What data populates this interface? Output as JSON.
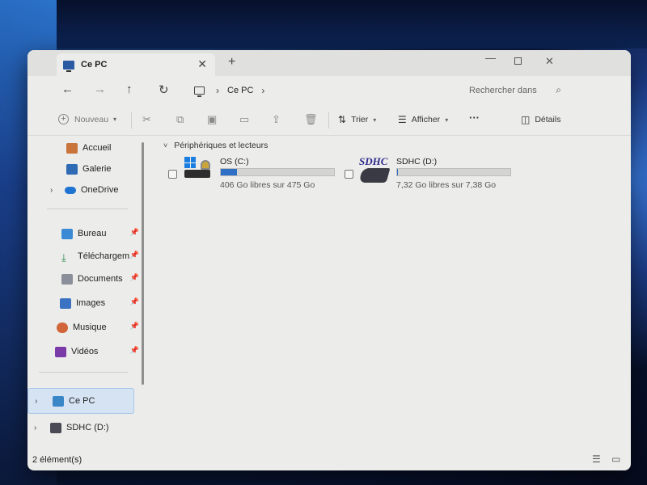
{
  "window": {
    "tab_title": "Ce PC",
    "tab_close": "✕",
    "new_tab": "+",
    "minimize": "—",
    "close": "✕"
  },
  "nav": {
    "back": "←",
    "forward": "→",
    "up": "↑",
    "refresh": "↻"
  },
  "address": {
    "sep1": "›",
    "crumb": "Ce PC",
    "sep2": "›"
  },
  "search": {
    "placeholder": "Rechercher dans"
  },
  "commands": {
    "new_label": "Nouveau",
    "sort_label": "Trier",
    "view_label": "Afficher",
    "more": "···",
    "details_label": "Détails"
  },
  "sidebar": {
    "top": [
      {
        "label": "Accueil"
      },
      {
        "label": "Galerie"
      },
      {
        "label": "OneDrive"
      }
    ],
    "quick": [
      {
        "label": "Bureau"
      },
      {
        "label": "Téléchargements"
      },
      {
        "label": "Documents"
      },
      {
        "label": "Images"
      },
      {
        "label": "Musique"
      },
      {
        "label": "Vidéos"
      }
    ],
    "bottom": [
      {
        "label": "Ce PC"
      },
      {
        "label": "SDHC (D:)"
      }
    ]
  },
  "content": {
    "group_title": "Périphériques et lecteurs",
    "drives": [
      {
        "name": "OS (C:)",
        "free_text": "406 Go libres sur 475 Go",
        "used_fraction": 0.145
      },
      {
        "name": "SDHC (D:)",
        "free_text": "7,32 Go libres sur 7,38 Go",
        "used_fraction": 0.008,
        "logo_text": "SDHC"
      }
    ]
  },
  "status": {
    "count": "2 élément(s)"
  },
  "colors": {
    "accent": "#2f6fc6",
    "selection": "#d5e3f3"
  }
}
